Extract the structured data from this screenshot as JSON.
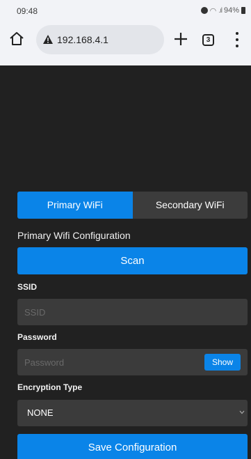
{
  "status_bar": {
    "time": "09:48",
    "battery": "94%"
  },
  "browser": {
    "url": "192.168.4.1",
    "tab_count": "3"
  },
  "tabs": [
    {
      "label": "Primary WiFi",
      "active": true
    },
    {
      "label": "Secondary WiFi",
      "active": false
    }
  ],
  "form": {
    "section_title": "Primary Wifi Configuration",
    "scan_label": "Scan",
    "ssid_label": "SSID",
    "ssid_placeholder": "SSID",
    "ssid_value": "",
    "password_label": "Password",
    "password_placeholder": "Password",
    "password_value": "",
    "show_label": "Show",
    "encryption_label": "Encryption Type",
    "encryption_value": "NONE",
    "save_label": "Save Configuration"
  },
  "colors": {
    "accent": "#0a84e8",
    "background": "#212121",
    "input_bg": "#3b3b3b",
    "browser_chrome": "#f2f3f7"
  }
}
